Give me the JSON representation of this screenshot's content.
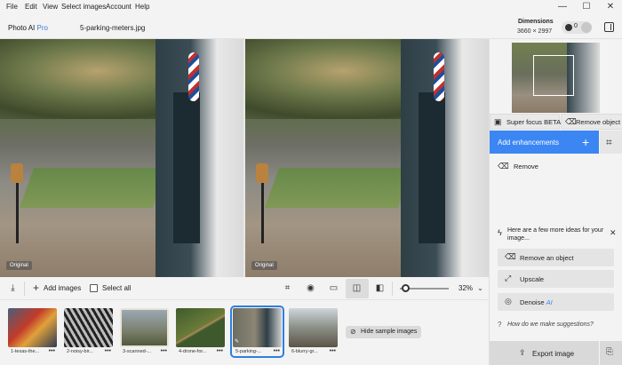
{
  "menu": [
    "File",
    "Edit",
    "View",
    "Select images",
    "Account",
    "Help"
  ],
  "window_controls": {
    "minimize": "—",
    "maximize": "☐",
    "close": "✕"
  },
  "header": {
    "app_name": "Photo AI",
    "app_tier": "Pro",
    "file_name": "5-parking-meters.jpg",
    "dimensions_label": "Dimensions",
    "dimensions_value": "3660 × 2997",
    "credits": "0"
  },
  "panes": {
    "left_tag": "Original",
    "right_tag": "Original"
  },
  "toolbar": {
    "add_images": "Add images",
    "select_all": "Select all",
    "zoom": "32%",
    "zoom_fraction": 0.1
  },
  "thumbnails": [
    {
      "label": "1-texas-the...",
      "more": "•••",
      "selected": false
    },
    {
      "label": "2-noisy-bir...",
      "more": "•••",
      "selected": false
    },
    {
      "label": "3-scanned-...",
      "more": "•••",
      "selected": false
    },
    {
      "label": "4-drone-for...",
      "more": "•••",
      "selected": false
    },
    {
      "label": "5-parking-...",
      "more": "•••",
      "selected": true
    },
    {
      "label": "6-blurry-gr...",
      "more": "•••",
      "selected": false
    }
  ],
  "hide_samples": "Hide sample images",
  "panel": {
    "super_focus": "Super focus BETA",
    "remove_object": "Remove object",
    "add_enhancements": "Add enhancements",
    "remove": "Remove",
    "ideas_text": "Here are a few more ideas for your image...",
    "ideas": [
      {
        "label": "Remove an object",
        "suffix": ""
      },
      {
        "label": "Upscale",
        "suffix": ""
      },
      {
        "label": "Denoise",
        "suffix": "AI"
      }
    ],
    "how_suggestions": "How do we make suggestions?",
    "export": "Export image"
  }
}
